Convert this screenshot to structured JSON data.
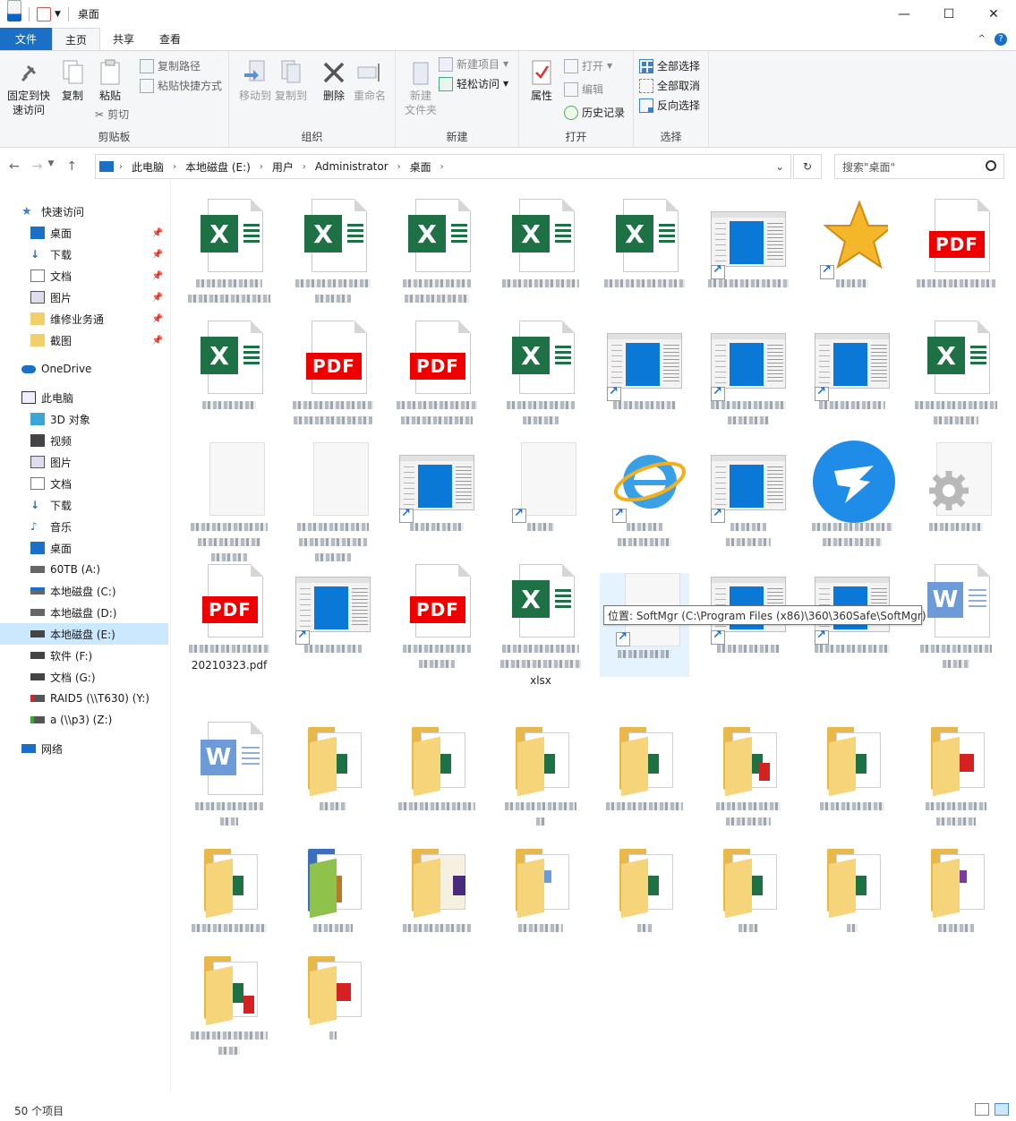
{
  "window": {
    "title": "桌面"
  },
  "tabs": {
    "file": "文件",
    "home": "主页",
    "share": "共享",
    "view": "查看"
  },
  "ribbon": {
    "clipboard": {
      "label": "剪贴板",
      "pin": "固定到快\n速访问",
      "copy": "复制",
      "paste": "粘贴",
      "copy_path": "复制路径",
      "paste_shortcut": "粘贴快捷方式",
      "cut": "剪切"
    },
    "organize": {
      "label": "组织",
      "move_to": "移动到",
      "copy_to": "复制到",
      "delete": "删除",
      "rename": "重命名"
    },
    "new": {
      "label": "新建",
      "new_folder": "新建\n文件夹",
      "new_item": "新建项目",
      "easy_access": "轻松访问"
    },
    "open": {
      "label": "打开",
      "properties": "属性",
      "open": "打开",
      "edit": "编辑",
      "history": "历史记录"
    },
    "select": {
      "label": "选择",
      "select_all": "全部选择",
      "select_none": "全部取消",
      "invert": "反向选择"
    }
  },
  "address": {
    "crumbs": [
      "此电脑",
      "本地磁盘 (E:)",
      "用户",
      "Administrator",
      "桌面"
    ],
    "search_placeholder": "搜索\"桌面\""
  },
  "sidebar": {
    "quick_access": "快速访问",
    "qa_items": [
      "桌面",
      "下载",
      "文档",
      "图片",
      "维修业务通",
      "截图"
    ],
    "onedrive": "OneDrive",
    "this_pc": "此电脑",
    "pc_items": [
      "3D 对象",
      "视频",
      "图片",
      "文档",
      "下载",
      "音乐",
      "桌面",
      "60TB (A:)",
      "本地磁盘 (C:)",
      "本地磁盘 (D:)",
      "本地磁盘 (E:)",
      "软件 (F:)",
      "文档 (G:)",
      "RAID5 (\\\\T630) (Y:)",
      "a (\\\\p3) (Z:)"
    ],
    "network": "网络"
  },
  "files": {
    "label_pdf_20210323": "20210323.pdf",
    "label_xlsx": "xlsx"
  },
  "tooltip": "位置: SoftMgr (C:\\Program Files (x86)\\360\\360Safe\\SoftMgr)",
  "status": {
    "count": "50 个项目"
  }
}
